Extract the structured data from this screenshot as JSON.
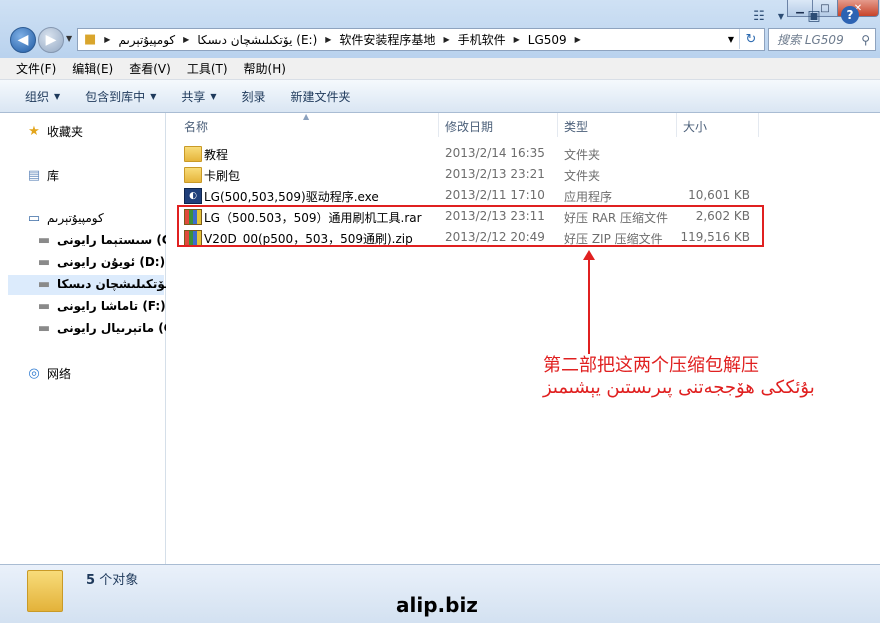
{
  "window": {
    "min_icon": "minimize-icon",
    "max_icon": "maximize-icon",
    "close_icon": "close-icon"
  },
  "address": {
    "segments": [
      "يۆتكىلىشچان دىسكا (E:)",
      "软件安装程序基地",
      "手机软件",
      "LG509"
    ],
    "computer_label": "كومپيۇتېرىم",
    "search_placeholder": "搜索 LG509"
  },
  "menu": [
    "文件(F)",
    "编辑(E)",
    "查看(V)",
    "工具(T)",
    "帮助(H)"
  ],
  "toolbar": {
    "organize": "组织",
    "include_library": "包含到库中",
    "share": "共享",
    "burn": "刻录",
    "new_folder": "新建文件夹"
  },
  "sidebar": {
    "favorites": "收藏夹",
    "library": "库",
    "computer": "كومپيۇتېرىم",
    "drives": [
      "سىستېما رايونى (C:)",
      "ئويۇن رايونى (D:)",
      "يۆتكىلىشچان دىسكا (E:",
      "تاماشا رايونى (F:)",
      "ماتېرىيال رايونى (G:)"
    ],
    "network": "网络"
  },
  "columns": {
    "name": "名称",
    "date": "修改日期",
    "type": "类型",
    "size": "大小"
  },
  "files": [
    {
      "name": "教程",
      "date": "2013/2/14 16:35",
      "type": "文件夹",
      "size": "",
      "icon": "folder-icon"
    },
    {
      "name": "卡刷包",
      "date": "2013/2/13 23:21",
      "type": "文件夹",
      "size": "",
      "icon": "folder-icon"
    },
    {
      "name": "LG(500,503,509)驱动程序.exe",
      "date": "2013/2/11 17:10",
      "type": "应用程序",
      "size": "10,601 KB",
      "icon": "exe-icon"
    },
    {
      "name": "LG（500.503，509）通用刷机工具.rar",
      "date": "2013/2/13 23:11",
      "type": "好压 RAR 压缩文件",
      "size": "2,602 KB",
      "icon": "archive-icon"
    },
    {
      "name": "V20D_00(p500，503，509通刷).zip",
      "date": "2013/2/12 20:49",
      "type": "好压 ZIP 压缩文件",
      "size": "119,516 KB",
      "icon": "archive-icon"
    }
  ],
  "annotation": {
    "line1": "第二部把这两个压缩包解压",
    "line2": "بۇئككى هۆججەتنى پىرىستىن يېشىمىز"
  },
  "status": {
    "count": "5",
    "count_suffix": "个对象"
  },
  "watermark": "alip.biz",
  "colors": {
    "accent_red": "#e02020",
    "toolbar_text": "#1e395b"
  }
}
